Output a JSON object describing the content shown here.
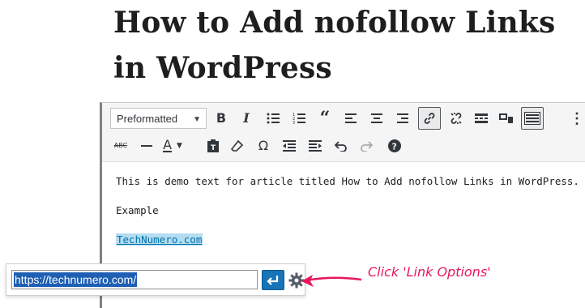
{
  "article": {
    "title_line1": "How to Add nofollow Links",
    "title_line2": "in WordPress"
  },
  "toolbar": {
    "format_select_value": "Preformatted",
    "row1_icons": [
      "bold-icon",
      "italic-icon",
      "bulleted-list-icon",
      "numbered-list-icon",
      "blockquote-icon",
      "align-left-icon",
      "align-center-icon",
      "align-right-icon",
      "link-icon",
      "unlink-icon",
      "read-more-icon",
      "toolbar-toggle-icon",
      "keyboard-icon",
      "more-options-icon"
    ],
    "row2_icons": [
      "strikethrough-icon",
      "horizontal-line-icon",
      "text-color-icon",
      "paste-as-text-icon",
      "clear-formatting-icon",
      "special-character-icon",
      "decrease-indent-icon",
      "increase-indent-icon",
      "undo-icon",
      "redo-icon",
      "help-icon"
    ],
    "active_button": "link-icon"
  },
  "content": {
    "paragraph1": "This is demo text for article titled How to Add nofollow Links in WordPress.",
    "paragraph2": "Example",
    "link_text": "TechNumero.com"
  },
  "link_popup": {
    "url_value": "https://technumero.com/",
    "apply_icon": "enter-icon",
    "options_icon": "gear-icon"
  },
  "annotation": {
    "text": "Click 'Link Options'",
    "color": "#e8175d"
  },
  "colors": {
    "link": "#0073aa",
    "apply_button": "#1874b8",
    "selection": "#1e5fb3"
  }
}
